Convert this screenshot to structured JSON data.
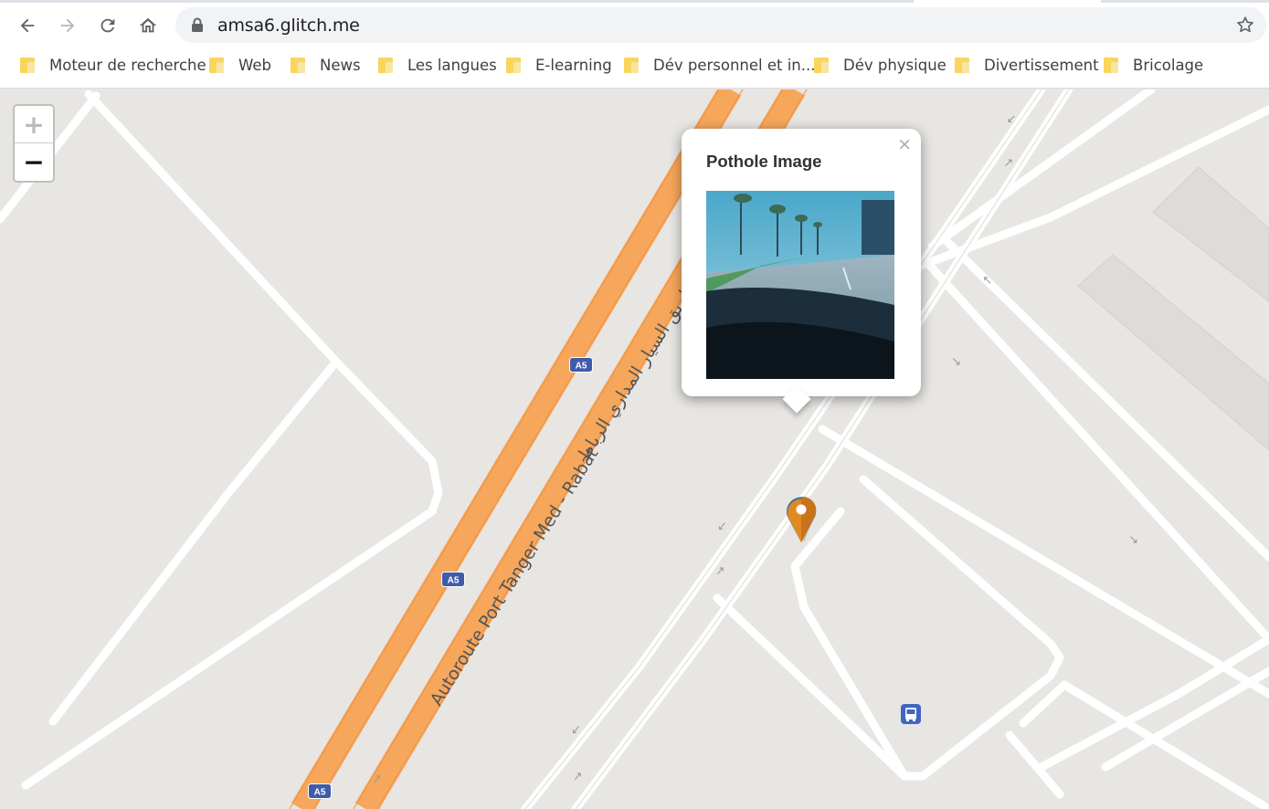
{
  "browser": {
    "url": "amsa6.glitch.me",
    "bookmarks": [
      "Moteur de recherche",
      "Web",
      "News",
      "Les langues",
      "E-learning",
      "Dév personnel et in...",
      "Dév physique",
      "Divertissement",
      "Bricolage"
    ]
  },
  "map": {
    "zoom_in_label": "+",
    "zoom_out_label": "−",
    "road_name": "Autoroute Port Tanger Med - Rabat",
    "road_name_ar": "الطريق السيار المداري الرباط",
    "highway_shield": "A5",
    "popup": {
      "title": "Pothole Image",
      "close_label": "×"
    },
    "colors": {
      "highway": "#f7a75c",
      "marker": "#e08a22",
      "bus_stop": "#3f66c3"
    }
  }
}
